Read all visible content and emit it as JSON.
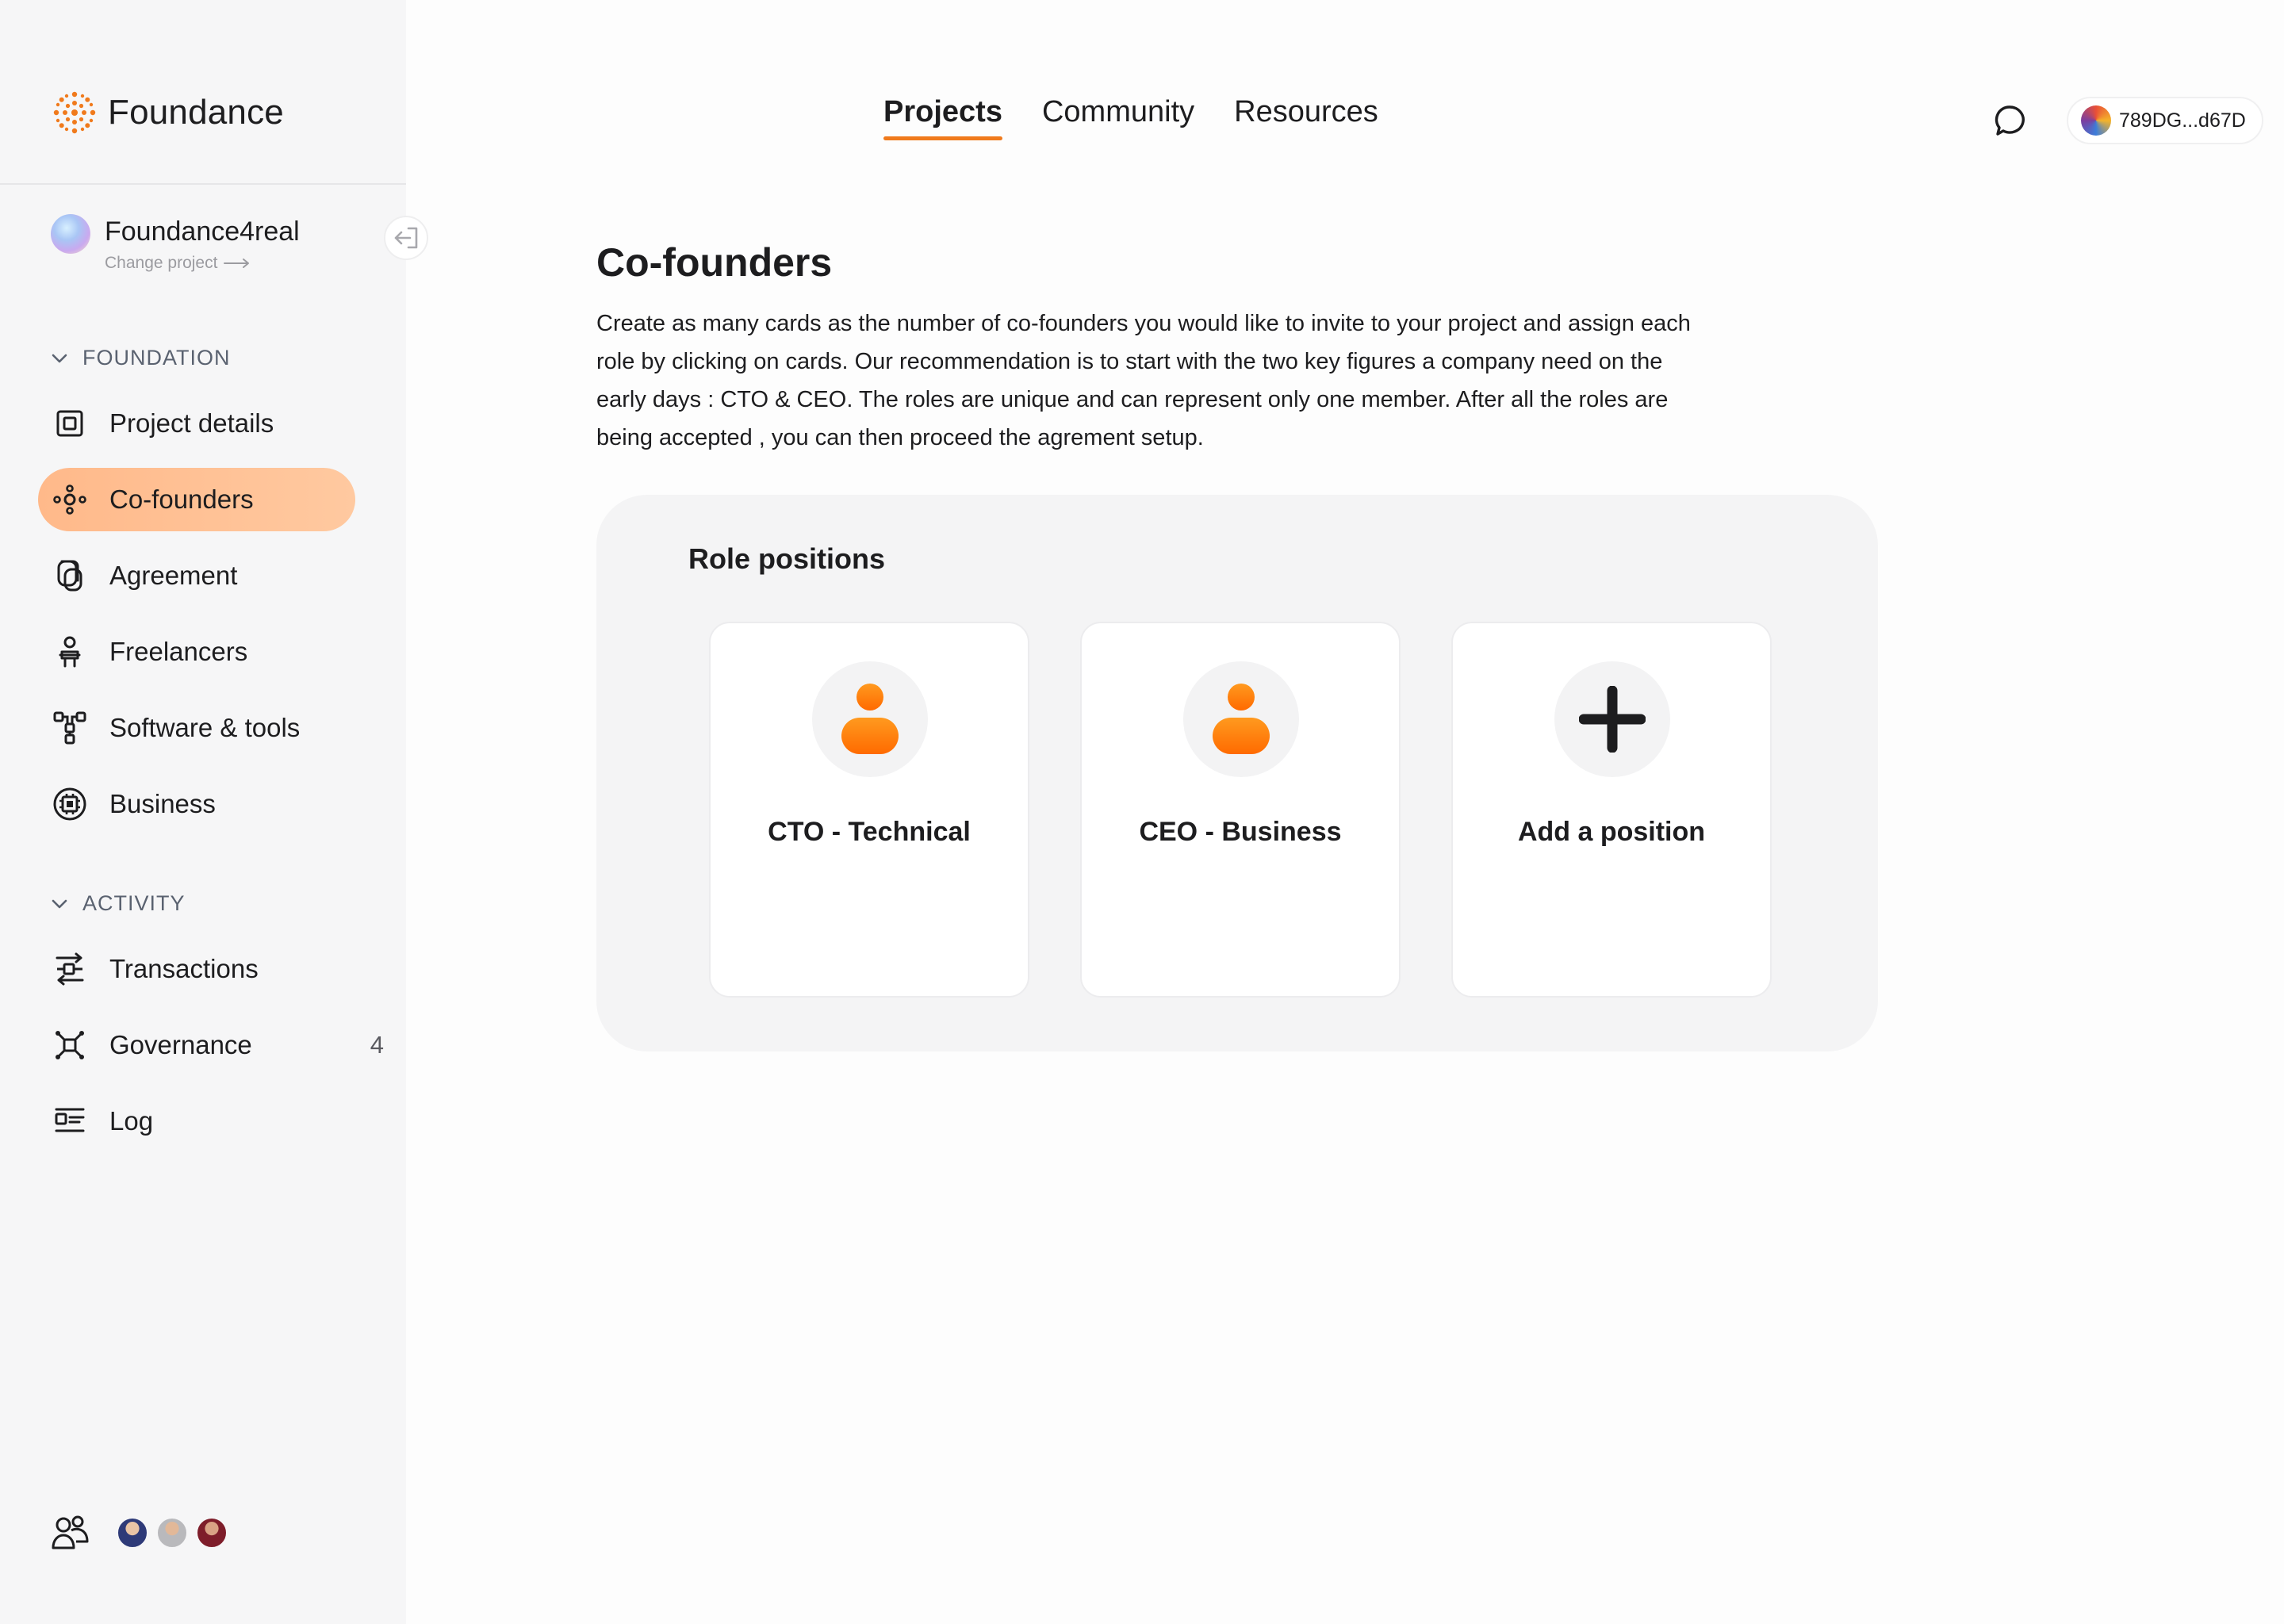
{
  "brand": {
    "name": "Foundance"
  },
  "project": {
    "name": "Foundance4real",
    "change_label": "Change project"
  },
  "sections": {
    "foundation": "FOUNDATION",
    "activity": "ACTIVITY"
  },
  "nav": {
    "project_details": "Project details",
    "cofounders": "Co-founders",
    "agreement": "Agreement",
    "freelancers": "Freelancers",
    "software_tools": "Software & tools",
    "business": "Business",
    "transactions": "Transactions",
    "governance": "Governance",
    "governance_badge": "4",
    "log": "Log"
  },
  "topnav": {
    "projects": "Projects",
    "community": "Community",
    "resources": "Resources"
  },
  "wallet": {
    "address": "789DG...d67D"
  },
  "page": {
    "title": "Co-founders",
    "description": "Create as many cards as the number of co-founders you would like to invite to your project and assign each role by clicking on cards. Our recommendation is to start with the two key figures a company need on the early days : CTO & CEO. The roles are unique and can represent only one member. After all the roles are being accepted , you can then proceed the agrement setup."
  },
  "roles": {
    "title": "Role positions",
    "cards": [
      {
        "label": "CTO - Technical",
        "icon": "person-icon"
      },
      {
        "label": "CEO - Business",
        "icon": "person-icon"
      },
      {
        "label": "Add a position",
        "icon": "plus-icon"
      }
    ]
  },
  "colors": {
    "accent": "#f07a1c",
    "active_nav": "#ffb98a",
    "sidebar_bg": "#f6f6f7",
    "panel_bg": "#f4f4f5"
  }
}
